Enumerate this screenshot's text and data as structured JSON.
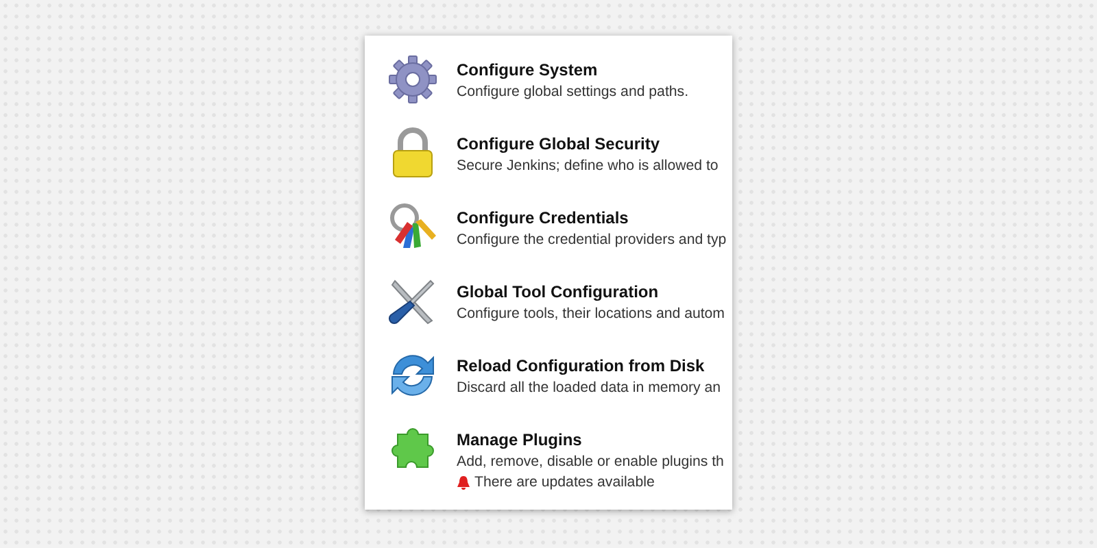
{
  "items": [
    {
      "title": "Configure System",
      "description": "Configure global settings and paths."
    },
    {
      "title": "Configure Global Security",
      "description": "Secure Jenkins; define who is allowed to"
    },
    {
      "title": "Configure Credentials",
      "description": "Configure the credential providers and typ"
    },
    {
      "title": "Global Tool Configuration",
      "description": "Configure tools, their locations and autom"
    },
    {
      "title": "Reload Configuration from Disk",
      "description": "Discard all the loaded data in memory an"
    },
    {
      "title": "Manage Plugins",
      "description": "Add, remove, disable or enable plugins th",
      "notice": "There are updates available"
    }
  ]
}
